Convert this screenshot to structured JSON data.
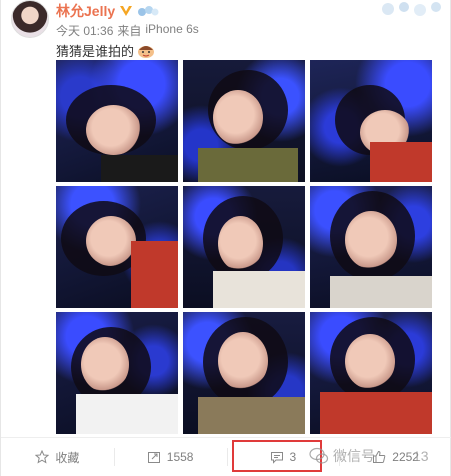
{
  "post": {
    "author": "林允Jelly",
    "time": "今天 01:36",
    "source_prefix": "来自",
    "source": "iPhone 6s",
    "text": "猜猜是谁拍的",
    "photo_count": 9
  },
  "actions": {
    "favorite_label": "收藏",
    "repost_count": "1558",
    "comment_count": "3",
    "like_count": "2252"
  },
  "watermark": {
    "text": "微信号",
    "suffix": "13"
  },
  "colors": {
    "author": "#eb7350",
    "meta": "#808080",
    "highlight": "#e03a3a"
  }
}
